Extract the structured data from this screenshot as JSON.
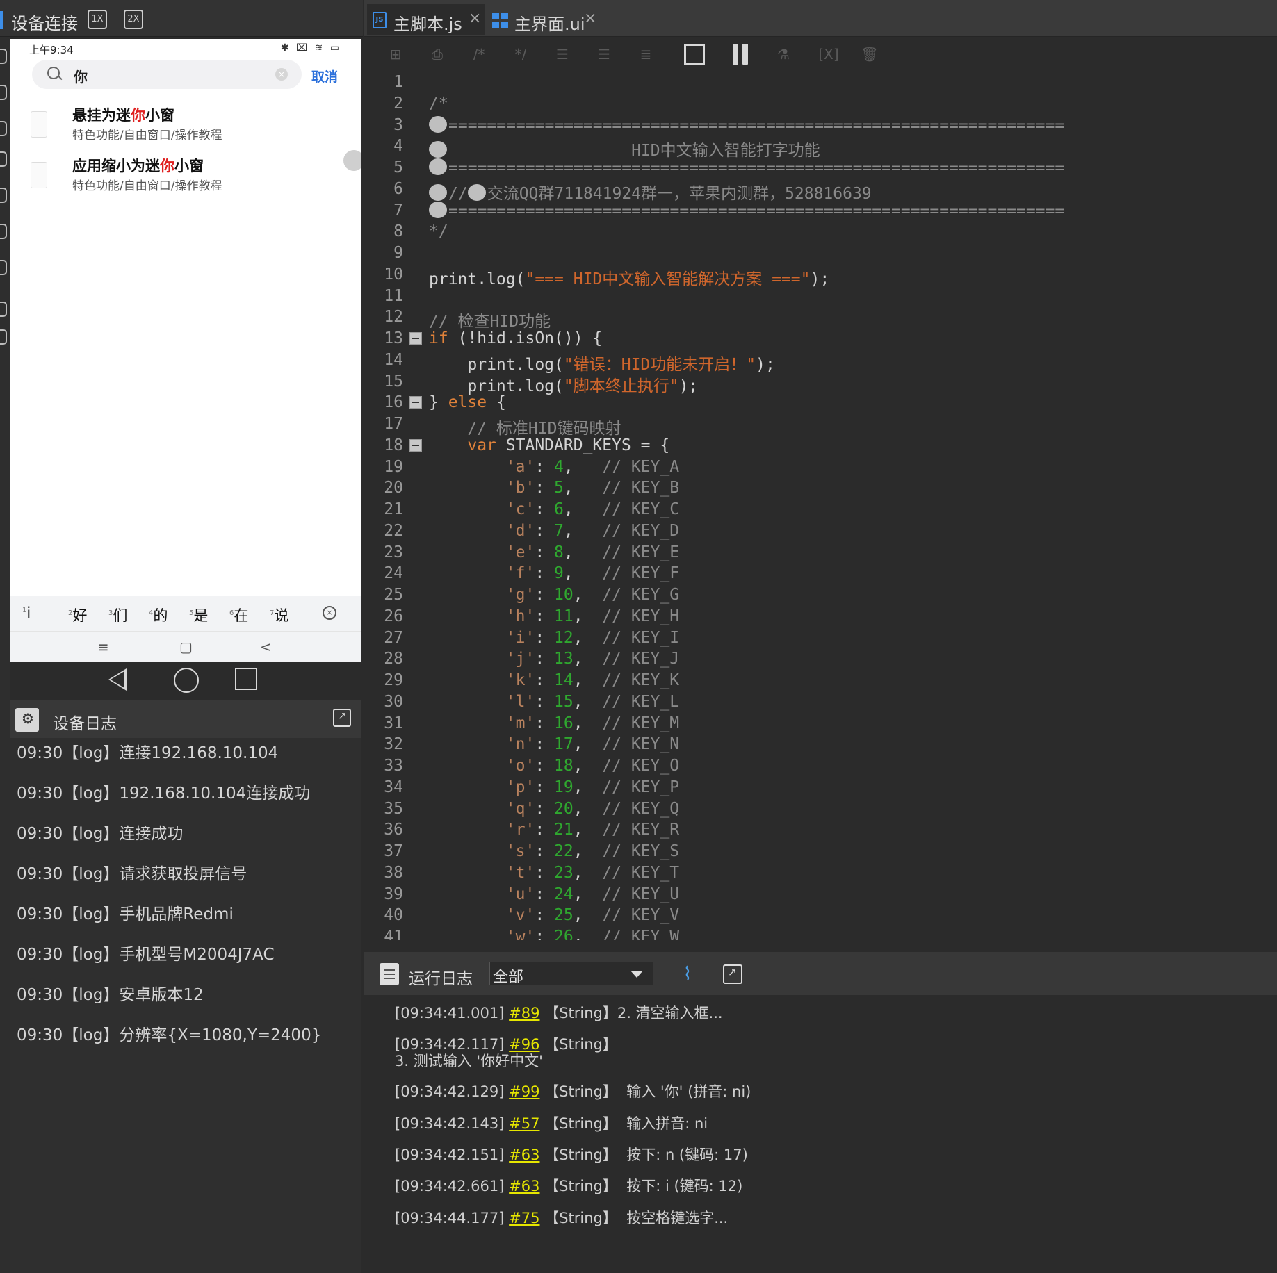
{
  "device_panel": {
    "title": "设备连接",
    "zoom_1x": "1X",
    "zoom_2x": "2X"
  },
  "phone": {
    "status_time": "上午9:34",
    "status_right": "✱ ⌧ ≋ ▭",
    "search_value": "你",
    "cancel_label": "取消",
    "results": [
      {
        "title_pre": "悬挂为迷",
        "title_hl": "你",
        "title_post": "小窗",
        "subtitle": "特色功能/自由窗口/操作教程"
      },
      {
        "title_pre": "应用缩小为迷",
        "title_hl": "你",
        "title_post": "小窗",
        "subtitle": "特色功能/自由窗口/操作教程"
      }
    ],
    "candidates": [
      {
        "num": "1",
        "text": "i"
      },
      {
        "num": "2",
        "text": "好"
      },
      {
        "num": "3",
        "text": "们"
      },
      {
        "num": "4",
        "text": "的"
      },
      {
        "num": "5",
        "text": "是"
      },
      {
        "num": "6",
        "text": "在"
      },
      {
        "num": "7",
        "text": "说"
      }
    ],
    "nav": {
      "menu": "≡",
      "home": "▢",
      "back": "<"
    }
  },
  "device_log": {
    "title": "设备日志",
    "entries": [
      "09:30【log】连接192.168.10.104",
      "09:30【log】192.168.10.104连接成功",
      "09:30【log】连接成功",
      "09:30【log】请求获取投屏信号",
      "09:30【log】手机品牌Redmi",
      "09:30【log】手机型号M2004J7AC",
      "09:30【log】安卓版本12",
      "09:30【log】分辨率{X=1080,Y=2400}"
    ]
  },
  "tabs": [
    {
      "label": "主脚本.js",
      "close": "×"
    },
    {
      "label": "主界面.ui",
      "close": "×"
    }
  ],
  "toolbar": {
    "debug_var": "[X]"
  },
  "editor": {
    "line_numbers": [
      "1",
      "2",
      "3",
      "4",
      "5",
      "6",
      "7",
      "8",
      "9",
      "10",
      "11",
      "12",
      "13",
      "14",
      "15",
      "16",
      "17",
      "18",
      "19",
      "20",
      "21",
      "22",
      "23",
      "24",
      "25",
      "26",
      "27",
      "28",
      "29",
      "30",
      "31",
      "32",
      "33",
      "34",
      "35",
      "36",
      "37",
      "38",
      "39",
      "40",
      "41"
    ],
    "comment_open": "/*",
    "comment_sep": "================================================================",
    "comment_title": "                   HID中文输入智能打字功能",
    "comment_qq_prefix": "//",
    "comment_qq": "交流QQ群711841924群一，苹果内测群，528816639",
    "comment_close": "*/",
    "line10": {
      "fn": "print.log(",
      "str": "\"=== HID中文输入智能解决方案 ===\"",
      "end": ");"
    },
    "line12": "// 检查HID功能",
    "line13": {
      "kw": "if",
      "rest": " (!hid.isOn()) {"
    },
    "line14": {
      "fn": "    print.log(",
      "str": "\"错误：HID功能未开启！\"",
      "end": ");"
    },
    "line15": {
      "fn": "    print.log(",
      "str": "\"脚本终止执行\"",
      "end": ");"
    },
    "line16": {
      "pre": "} ",
      "kw": "else",
      "post": " {"
    },
    "line17": "    // 标准HID键码映射",
    "line18": {
      "kw": "    var",
      "rest": " STANDARD_KEYS = {"
    },
    "key_map": [
      {
        "key": "'a'",
        "code": "4",
        "comment": "// KEY_A"
      },
      {
        "key": "'b'",
        "code": "5",
        "comment": "// KEY_B"
      },
      {
        "key": "'c'",
        "code": "6",
        "comment": "// KEY_C"
      },
      {
        "key": "'d'",
        "code": "7",
        "comment": "// KEY_D"
      },
      {
        "key": "'e'",
        "code": "8",
        "comment": "// KEY_E"
      },
      {
        "key": "'f'",
        "code": "9",
        "comment": "// KEY_F"
      },
      {
        "key": "'g'",
        "code": "10",
        "comment": "// KEY_G"
      },
      {
        "key": "'h'",
        "code": "11",
        "comment": "// KEY_H"
      },
      {
        "key": "'i'",
        "code": "12",
        "comment": "// KEY_I"
      },
      {
        "key": "'j'",
        "code": "13",
        "comment": "// KEY_J"
      },
      {
        "key": "'k'",
        "code": "14",
        "comment": "// KEY_K"
      },
      {
        "key": "'l'",
        "code": "15",
        "comment": "// KEY_L"
      },
      {
        "key": "'m'",
        "code": "16",
        "comment": "// KEY_M"
      },
      {
        "key": "'n'",
        "code": "17",
        "comment": "// KEY_N"
      },
      {
        "key": "'o'",
        "code": "18",
        "comment": "// KEY_O"
      },
      {
        "key": "'p'",
        "code": "19",
        "comment": "// KEY_P"
      },
      {
        "key": "'q'",
        "code": "20",
        "comment": "// KEY_Q"
      },
      {
        "key": "'r'",
        "code": "21",
        "comment": "// KEY_R"
      },
      {
        "key": "'s'",
        "code": "22",
        "comment": "// KEY_S"
      },
      {
        "key": "'t'",
        "code": "23",
        "comment": "// KEY_T"
      },
      {
        "key": "'u'",
        "code": "24",
        "comment": "// KEY_U"
      },
      {
        "key": "'v'",
        "code": "25",
        "comment": "// KEY_V"
      },
      {
        "key": "'w'",
        "code": "26",
        "comment": "// KEY_W"
      }
    ]
  },
  "run_log": {
    "title": "运行日志",
    "filter_value": "全部",
    "entries": [
      {
        "time": "[09:34:41.001]",
        "ref": "#89",
        "type": "【String】",
        "msg": "2. 清空输入框..."
      },
      {
        "time": "[09:34:42.117]",
        "ref": "#96",
        "type": "【String】",
        "msg": "",
        "msg2": "3. 测试输入 '你好中文'"
      },
      {
        "time": "[09:34:42.129]",
        "ref": "#99",
        "type": "【String】",
        "msg": "  输入 '你' (拼音: ni)"
      },
      {
        "time": "[09:34:42.143]",
        "ref": "#57",
        "type": "【String】",
        "msg": "  输入拼音: ni"
      },
      {
        "time": "[09:34:42.151]",
        "ref": "#63",
        "type": "【String】",
        "msg": "  按下: n (键码: 17)"
      },
      {
        "time": "[09:34:42.661]",
        "ref": "#63",
        "type": "【String】",
        "msg": "  按下: i (键码: 12)"
      },
      {
        "time": "[09:34:44.177]",
        "ref": "#75",
        "type": "【String】",
        "msg": "  按空格键选字..."
      }
    ]
  }
}
